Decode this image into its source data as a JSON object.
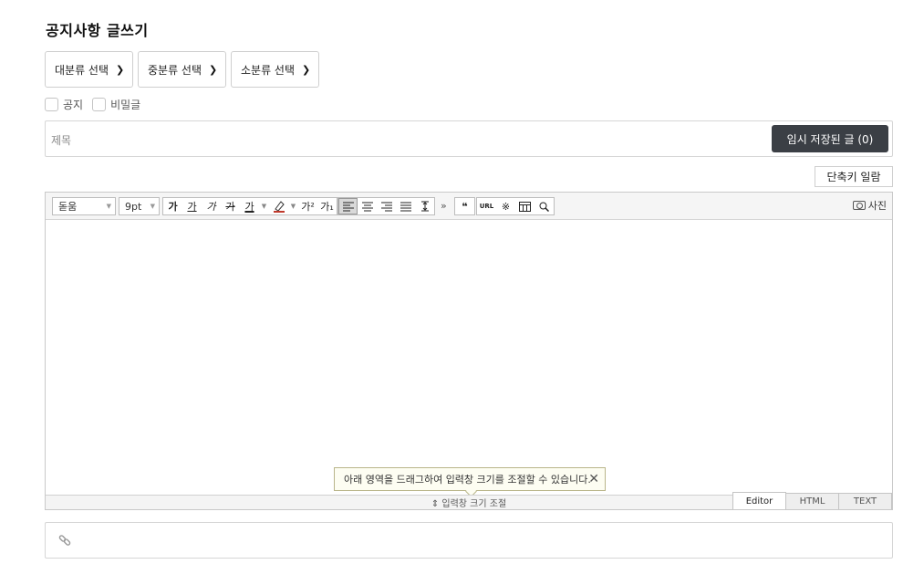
{
  "page": {
    "title": "공지사항 글쓰기"
  },
  "categories": [
    {
      "label": "대분류 선택"
    },
    {
      "label": "중분류 선택"
    },
    {
      "label": "소분류 선택"
    }
  ],
  "options": {
    "notice_label": "공지",
    "secret_label": "비밀글"
  },
  "title_field": {
    "placeholder": "제목",
    "draft_button": "임시 저장된 글 (0)"
  },
  "shortcut_button": "단축키 일람",
  "toolbar": {
    "font_family": "돋움",
    "font_size": "9pt",
    "bold": "가",
    "underline": "가",
    "italic": "가",
    "strike": "가",
    "font_color": "가",
    "superscript": "가²",
    "subscript": "가₁",
    "more": "»",
    "quote": "❝",
    "url": "URL",
    "special_char": "※",
    "photo_label": "사진"
  },
  "tooltip": {
    "text": "아래 영역을 드래그하여 입력창 크기를 조절할 수 있습니다."
  },
  "resize_bar": {
    "label": "⇕ 입력창 크기 조절"
  },
  "mode_tabs": [
    "Editor",
    "HTML",
    "TEXT"
  ],
  "colors": {
    "draft_button_bg": "#3b3f45",
    "tooltip_bg": "#fdfdf2",
    "toolbar_bg": "#f5f5f5"
  }
}
